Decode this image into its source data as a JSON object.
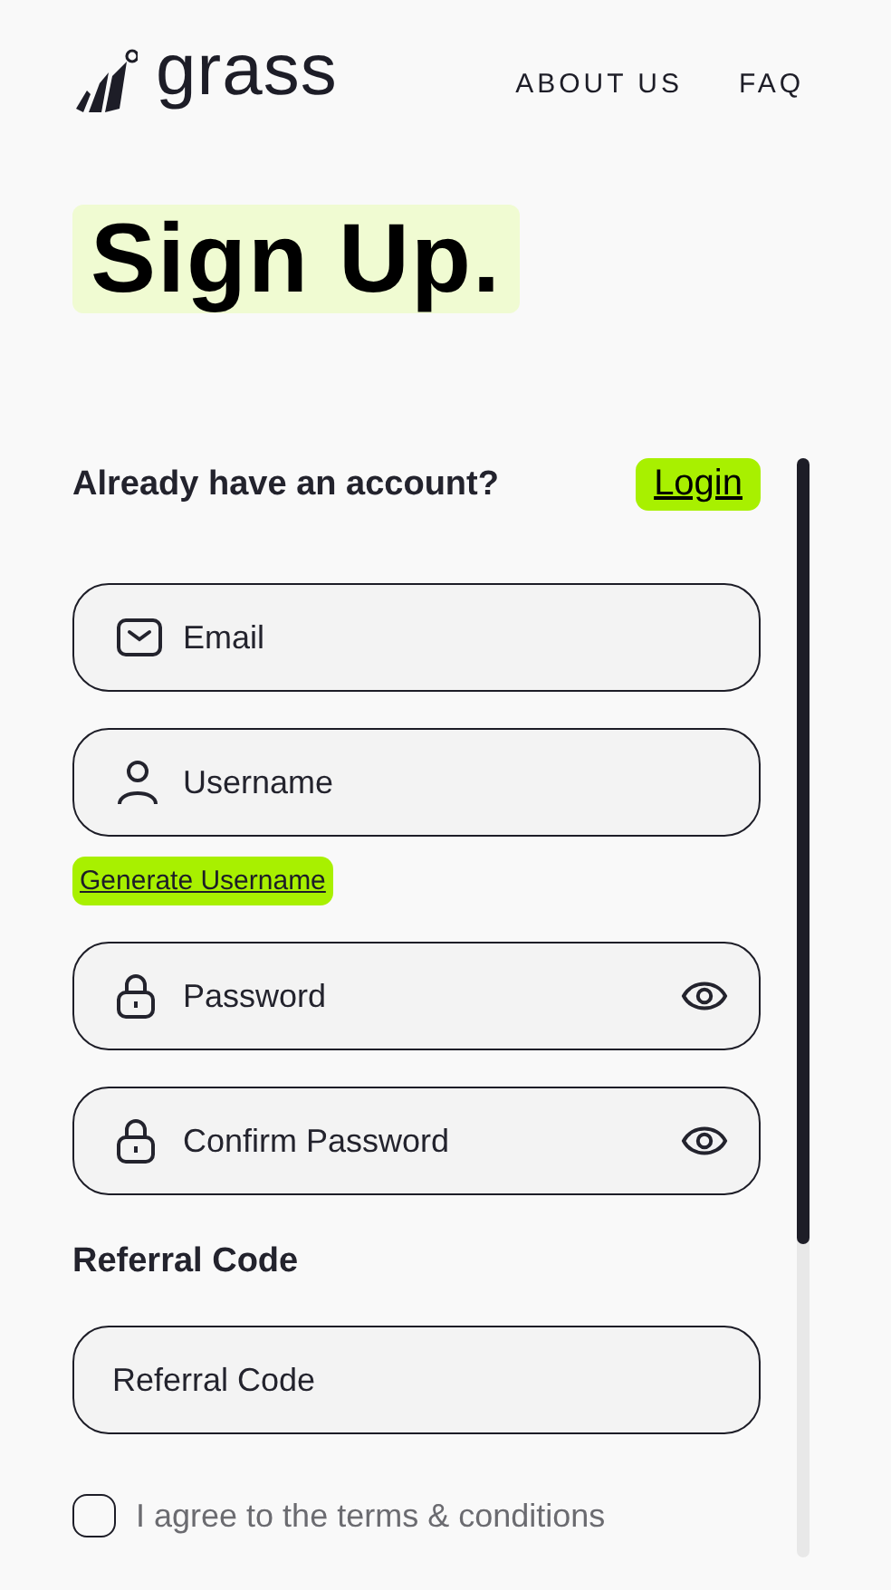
{
  "header": {
    "logo": "grass",
    "nav": [
      "ABOUT US",
      "FAQ"
    ]
  },
  "title": "Sign Up.",
  "account_prompt": "Already have an account?",
  "login_button": "Login",
  "account_fields": [
    {
      "kind": "email",
      "placeholder": "Email"
    },
    {
      "kind": "username",
      "placeholder": "Username"
    }
  ],
  "generate_username_button": "Generate Username",
  "password_fields": [
    {
      "kind": "password",
      "placeholder": "Password"
    },
    {
      "kind": "password",
      "placeholder": "Confirm Password"
    }
  ],
  "referral": {
    "label": "Referral Code",
    "placeholder": "Referral Code"
  },
  "terms": {
    "label": "I agree to the terms & conditions",
    "checked": false
  }
}
